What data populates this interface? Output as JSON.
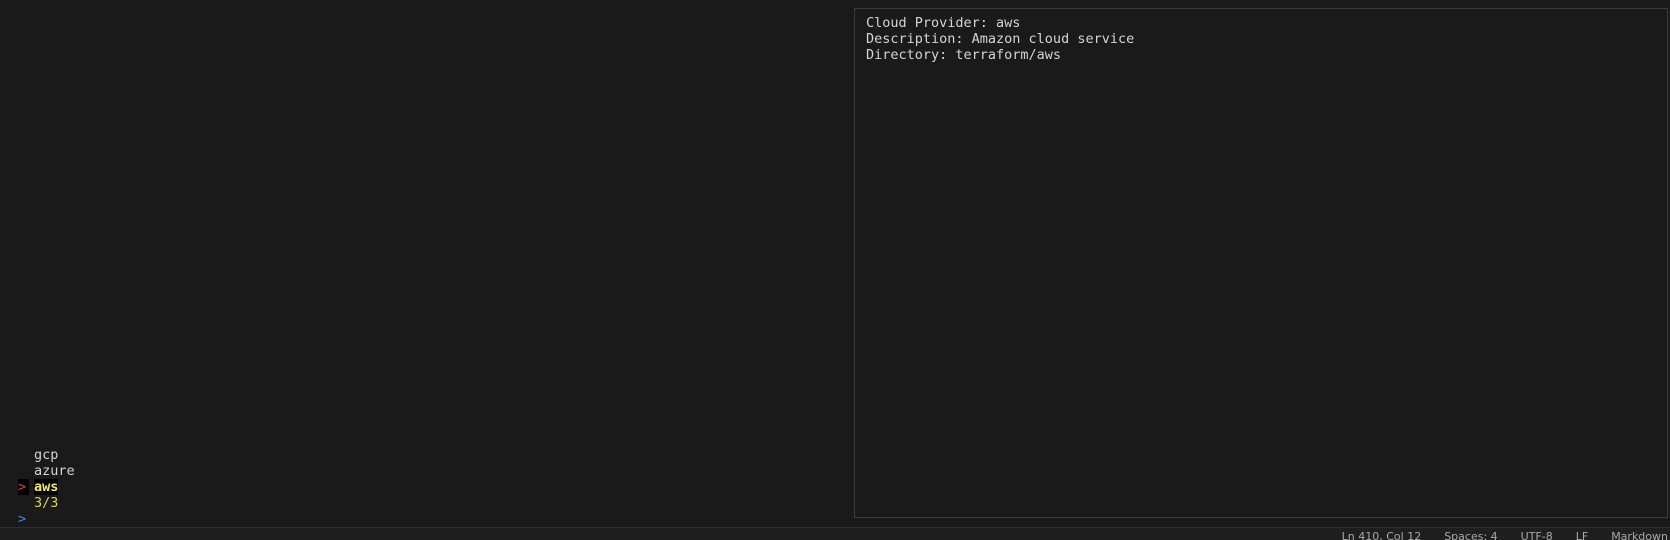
{
  "preview": {
    "lines": [
      "Cloud Provider: aws",
      "Description: Amazon cloud service",
      "Directory: terraform/aws"
    ]
  },
  "picker": {
    "items": [
      "gcp",
      "azure",
      "aws"
    ],
    "selected_index": 2,
    "pointer": ">",
    "count": "3/3",
    "prompt": ">"
  },
  "statusbar": {
    "position": "Ln 410, Col 12",
    "spaces": "Spaces: 4",
    "encoding": "UTF-8",
    "eol": "LF",
    "language": "Markdown"
  },
  "colors": {
    "background": "#1a1a1a",
    "pointer": "#e04040",
    "selected": "#f2ee6a",
    "count": "#d7d74a",
    "prompt": "#3a8fdf"
  }
}
